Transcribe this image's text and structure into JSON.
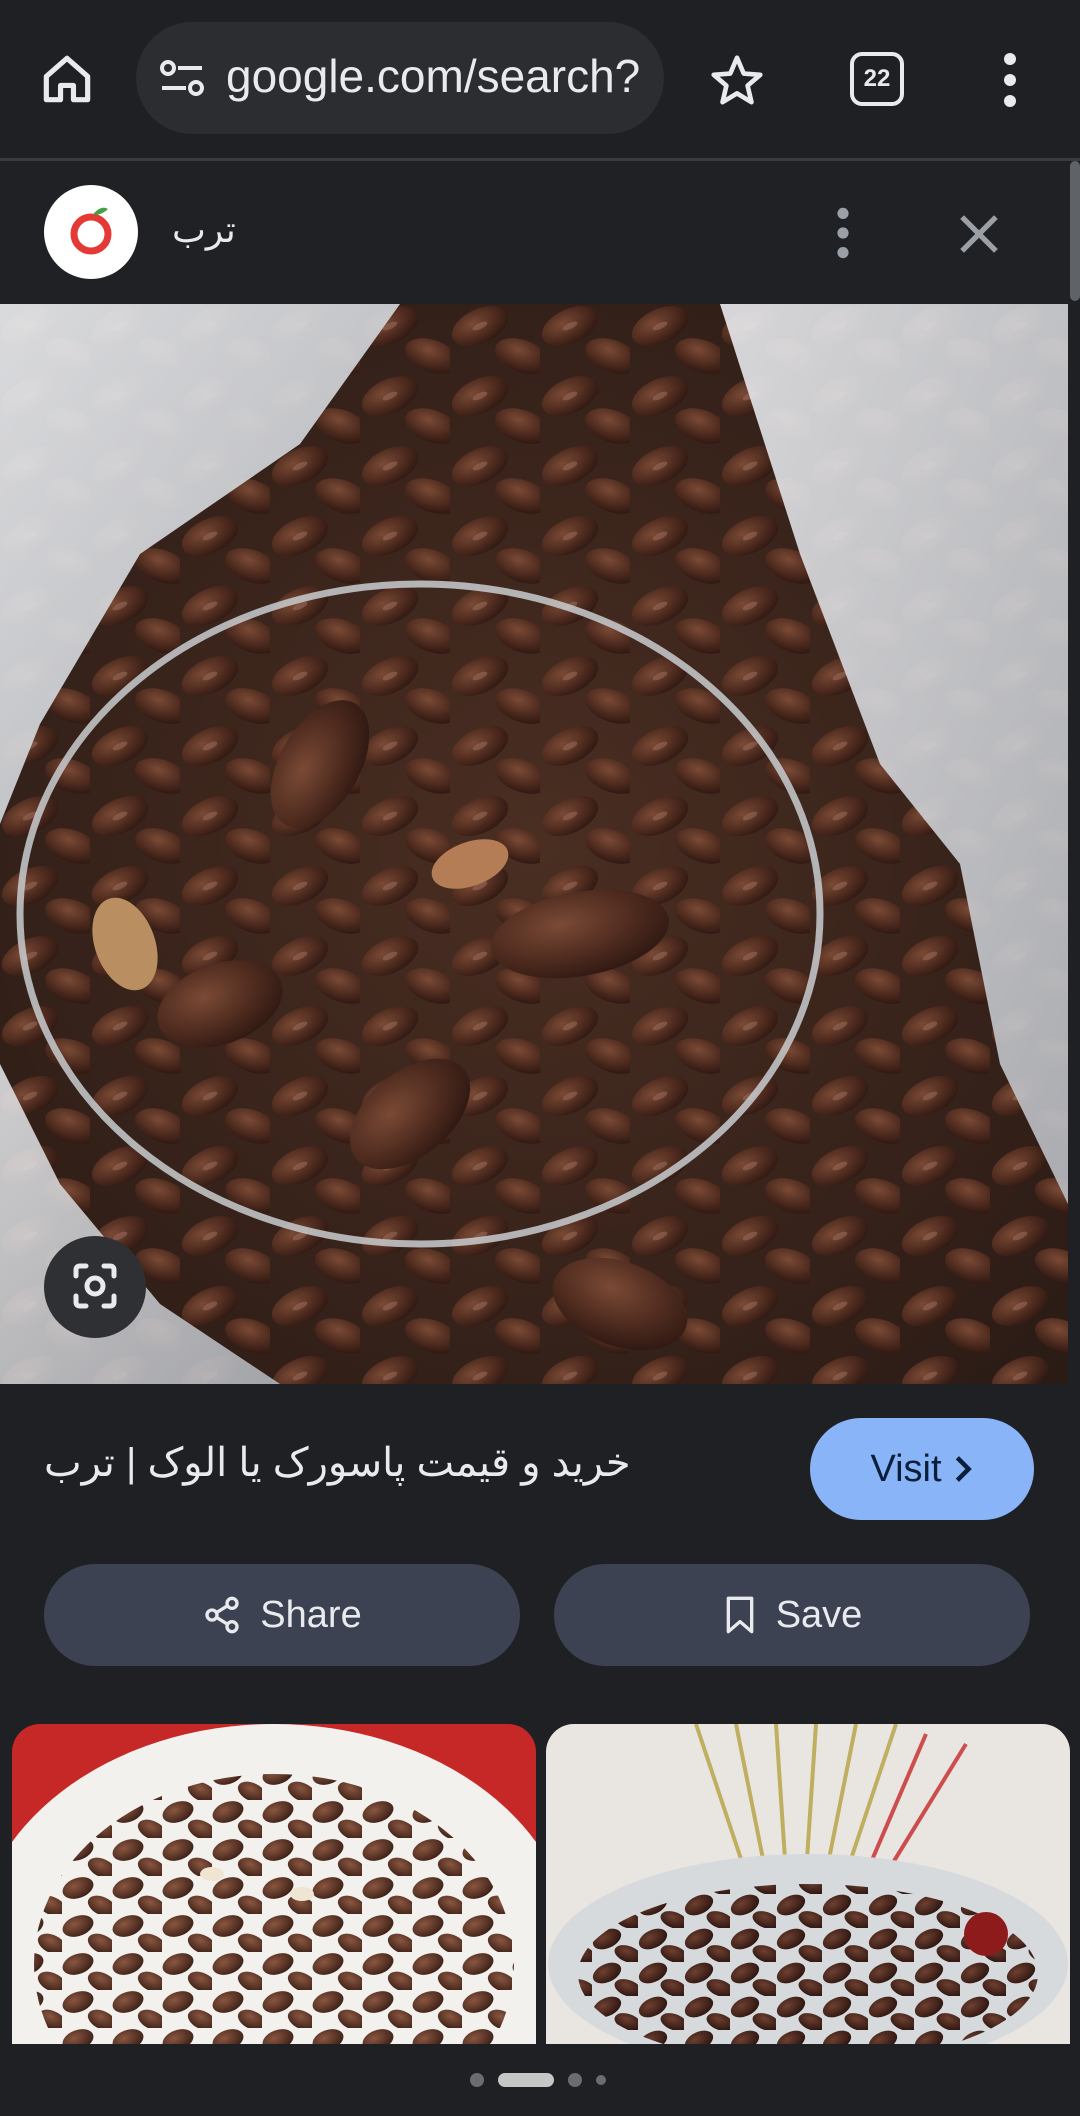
{
  "browser": {
    "url": "google.com/search?",
    "tab_count": "22"
  },
  "source": {
    "name": "ترب"
  },
  "result": {
    "title": "خرید و قیمت پاسورک یا الوک | ترب",
    "visit_label": "Visit",
    "share_label": "Share",
    "save_label": "Save"
  },
  "colors": {
    "accent": "#8ab4f8",
    "background": "#1f2024",
    "button_bg": "#3c4252",
    "logo_red": "#e53935"
  },
  "icons": [
    "home-icon",
    "site-info-icon",
    "star-icon",
    "tabs-icon",
    "more-vert-icon",
    "close-icon",
    "lens-icon",
    "share-icon",
    "bookmark-icon",
    "chevron-right-icon"
  ]
}
